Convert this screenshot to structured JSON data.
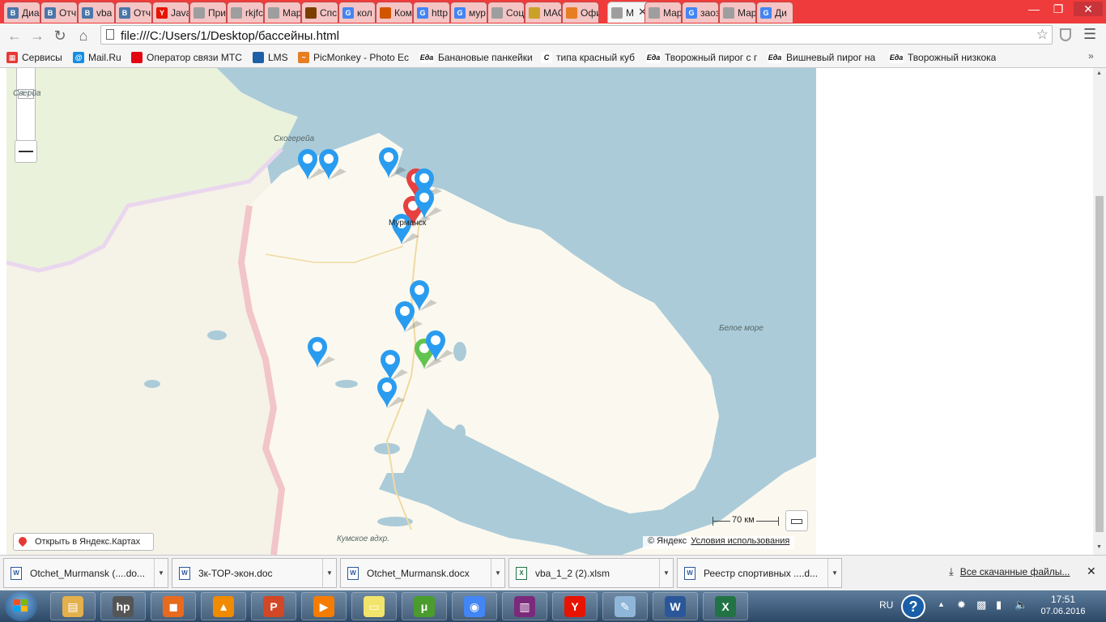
{
  "browser": {
    "tabs": [
      {
        "title": "Диа",
        "icon": "vk-icon",
        "color": "#4a76a8",
        "glyph": "В"
      },
      {
        "title": "Отч",
        "icon": "vk-icon",
        "color": "#4a76a8",
        "glyph": "В"
      },
      {
        "title": "vba",
        "icon": "vk-icon",
        "color": "#4a76a8",
        "glyph": "В"
      },
      {
        "title": "Отч",
        "icon": "vk-icon",
        "color": "#4a76a8",
        "glyph": "В"
      },
      {
        "title": "Java",
        "icon": "yandex-icon",
        "color": "#e61400",
        "glyph": "Y"
      },
      {
        "title": "При",
        "icon": "page-icon",
        "color": "#9e9e9e",
        "glyph": ""
      },
      {
        "title": "rkjfc",
        "icon": "page-icon",
        "color": "#9e9e9e",
        "glyph": ""
      },
      {
        "title": "Мар",
        "icon": "page-icon",
        "color": "#9e9e9e",
        "glyph": ""
      },
      {
        "title": "Спс",
        "icon": "site-icon",
        "color": "#7b3f00",
        "glyph": ""
      },
      {
        "title": "кол",
        "icon": "google-icon",
        "color": "#4285f4",
        "glyph": "G"
      },
      {
        "title": "Ком",
        "icon": "site-icon",
        "color": "#d35400",
        "glyph": ""
      },
      {
        "title": "http",
        "icon": "google-icon",
        "color": "#4285f4",
        "glyph": "G"
      },
      {
        "title": "мур",
        "icon": "google-icon",
        "color": "#4285f4",
        "glyph": "G"
      },
      {
        "title": "Соц",
        "icon": "page-icon",
        "color": "#9e9e9e",
        "glyph": ""
      },
      {
        "title": "МАС",
        "icon": "emblem-icon",
        "color": "#c9a227",
        "glyph": ""
      },
      {
        "title": "Офи",
        "icon": "site-icon",
        "color": "#e67e22",
        "glyph": ""
      },
      {
        "title": "М",
        "icon": "page-icon",
        "color": "#9e9e9e",
        "glyph": "",
        "active": true
      },
      {
        "title": "Мар",
        "icon": "page-icon",
        "color": "#9e9e9e",
        "glyph": ""
      },
      {
        "title": "заоз",
        "icon": "google-icon",
        "color": "#4285f4",
        "glyph": "G"
      },
      {
        "title": "Мар",
        "icon": "page-icon",
        "color": "#9e9e9e",
        "glyph": ""
      },
      {
        "title": "Ди",
        "icon": "google-icon",
        "color": "#4285f4",
        "glyph": "G"
      }
    ],
    "url": "file:///C:/Users/1/Desktop/бассейны.html",
    "bookmarks": [
      {
        "label": "Сервисы",
        "icon": "apps-grid-icon",
        "color": "#e53935",
        "glyph": "▦"
      },
      {
        "label": "Mail.Ru",
        "icon": "mailru-icon",
        "color": "#168de2",
        "glyph": "@"
      },
      {
        "label": "Оператор связи МТС",
        "icon": "mts-icon",
        "color": "#e30611",
        "glyph": ""
      },
      {
        "label": "LMS",
        "icon": "lms-icon",
        "color": "#1e5fa8",
        "glyph": ""
      },
      {
        "label": "PicMonkey - Photo Ec",
        "icon": "picmonkey-icon",
        "color": "#e67e22",
        "glyph": "~"
      },
      {
        "label": "Банановые панкейки",
        "icon": "eda-icon",
        "color": "#ffffff",
        "glyph": "Еда"
      },
      {
        "label": "типа красный куб",
        "icon": "c-logo-icon",
        "color": "#ffffff",
        "glyph": "C"
      },
      {
        "label": "Творожный пирог с г",
        "icon": "eda-icon",
        "color": "#ffffff",
        "glyph": "Еда"
      },
      {
        "label": "Вишневый пирог на",
        "icon": "eda-icon",
        "color": "#ffffff",
        "glyph": "Еда"
      },
      {
        "label": "Творожный низкока",
        "icon": "eda-icon",
        "color": "#ffffff",
        "glyph": "Еда"
      }
    ]
  },
  "map": {
    "labels": {
      "sweden": "Сверйа",
      "skogereia": "Скогерейа",
      "murmansk": "Мурманск",
      "white_sea": "Белое море",
      "kumskoe": "Кумское вдхр."
    },
    "markers": [
      {
        "color": "#2a9cf0",
        "name": "marker-pin-blue"
      },
      {
        "color": "#e64040",
        "name": "marker-pin-red"
      },
      {
        "color": "#62c44f",
        "name": "marker-pin-green"
      }
    ],
    "scale_label": "70 км",
    "open_link": "Открыть в Яндекс.Картах",
    "copyright": "© Яндекс",
    "terms": "Условия использования",
    "colors": {
      "water": "#abcbd9",
      "land": "#fbf9ef",
      "finland": "#f5f2e8",
      "russia_border": "#f2c5c8"
    }
  },
  "downloads": {
    "items": [
      {
        "name": "Otchet_Murmansk (....do...",
        "type": "word"
      },
      {
        "name": "3к-ТОР-экон.doc",
        "type": "word"
      },
      {
        "name": "Otchet_Murmansk.docx",
        "type": "word"
      },
      {
        "name": "vba_1_2 (2).xlsm",
        "type": "excel"
      },
      {
        "name": "Реестр спортивных ....d...",
        "type": "word"
      }
    ],
    "all_label": "Все скачанные файлы..."
  },
  "taskbar": {
    "apps": [
      {
        "name": "explorer",
        "color": "#e3b04b",
        "glyph": "▤"
      },
      {
        "name": "hp",
        "color": "#555555",
        "glyph": "hp"
      },
      {
        "name": "office-tools",
        "color": "#e86a1e",
        "glyph": "◼"
      },
      {
        "name": "vlc",
        "color": "#f08a00",
        "glyph": "▲"
      },
      {
        "name": "powerpoint",
        "color": "#d24726",
        "glyph": "P"
      },
      {
        "name": "media-player",
        "color": "#f57c00",
        "glyph": "▶"
      },
      {
        "name": "sticky-notes",
        "color": "#f3e46b",
        "glyph": "▭"
      },
      {
        "name": "utorrent",
        "color": "#4a9c2d",
        "glyph": "μ"
      },
      {
        "name": "chrome",
        "color": "#4285f4",
        "glyph": "◉"
      },
      {
        "name": "winrar",
        "color": "#7b2a7b",
        "glyph": "▥"
      },
      {
        "name": "yandex-browser",
        "color": "#e61400",
        "glyph": "Y"
      },
      {
        "name": "notepad",
        "color": "#8fb6d8",
        "glyph": "✎"
      },
      {
        "name": "word",
        "color": "#2b579a",
        "glyph": "W"
      },
      {
        "name": "excel",
        "color": "#217346",
        "glyph": "X"
      }
    ],
    "lang": "RU",
    "time": "17:51",
    "date": "07.06.2016"
  }
}
